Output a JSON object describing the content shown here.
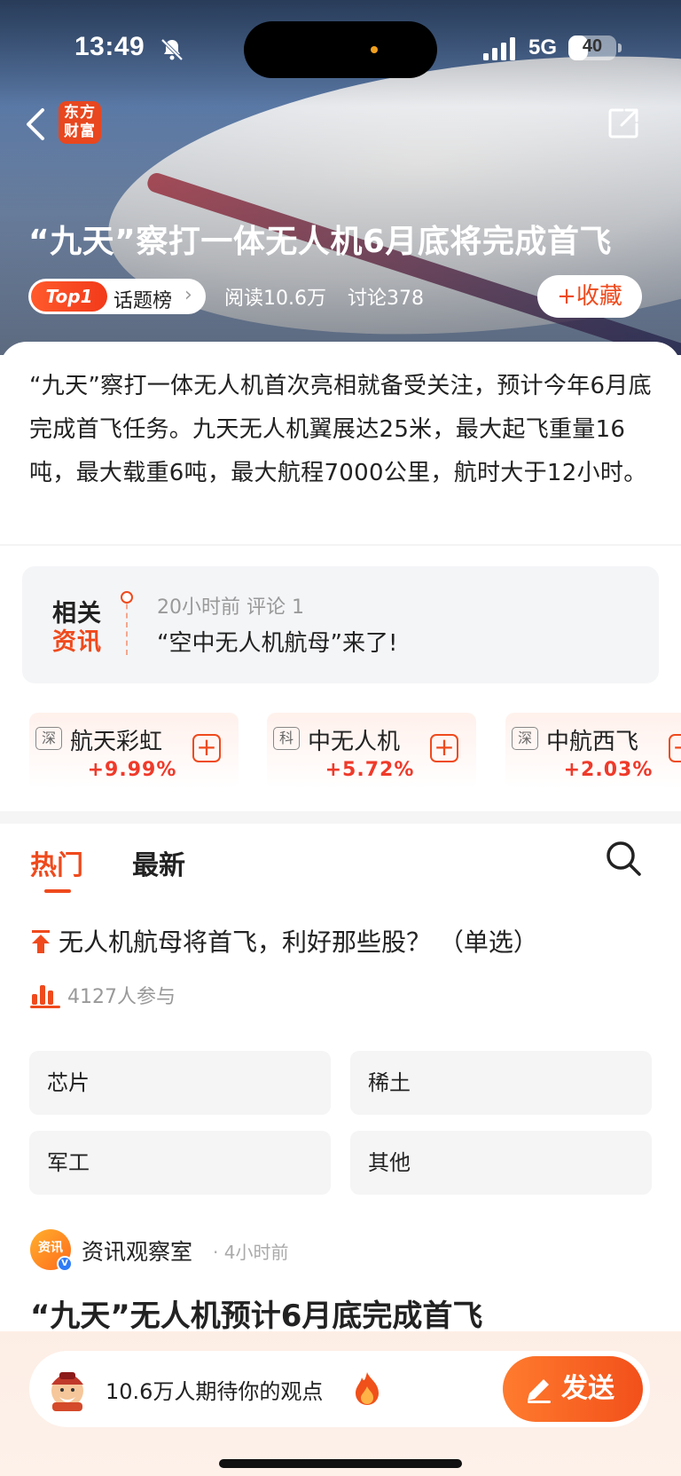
{
  "status_bar": {
    "time": "13:49",
    "network": "5G",
    "battery": "40",
    "battery_level": 0.4
  },
  "header": {
    "logo_text": "东方\n财富"
  },
  "hero": {
    "title": "“九天”察打一体无人机6月底将完成首飞",
    "topic_rank": "Top1",
    "topic_label": "话题榜",
    "reads": "阅读10.6万",
    "discussions": "讨论378",
    "favorite_label": "+收藏"
  },
  "summary": "“九天”察打一体无人机首次亮相就备受关注，预计今年6月底完成首飞任务。九天无人机翼展达25米，最大起飞重量16吨，最大载重6吨，最大航程7000公里，航时大于12小时。",
  "related": {
    "badge_line1": "相关",
    "badge_line2": "资讯",
    "meta": "20小时前  评论 1",
    "title": "“空中无人机航母”来了!"
  },
  "stocks": [
    {
      "market": "深",
      "name": "航天彩虹",
      "change": "+9.99%"
    },
    {
      "market": "科",
      "name": "中无人机",
      "change": "+5.72%"
    },
    {
      "market": "深",
      "name": "中航西飞",
      "change": "+2.03%"
    }
  ],
  "tabs": {
    "hot": "热门",
    "latest": "最新"
  },
  "poll": {
    "question": "无人机航母将首飞，利好那些股？  （单选）",
    "participants": "4127人参与",
    "options": [
      "芯片",
      "稀土",
      "军工",
      "其他"
    ]
  },
  "post": {
    "avatar_text": "资讯",
    "author": "资讯观察室",
    "time": "· 4小时前",
    "title": "“九天”无人机预计6月底完成首飞"
  },
  "composer": {
    "placeholder": "10.6万人期待你的观点",
    "send_label": "发送"
  }
}
